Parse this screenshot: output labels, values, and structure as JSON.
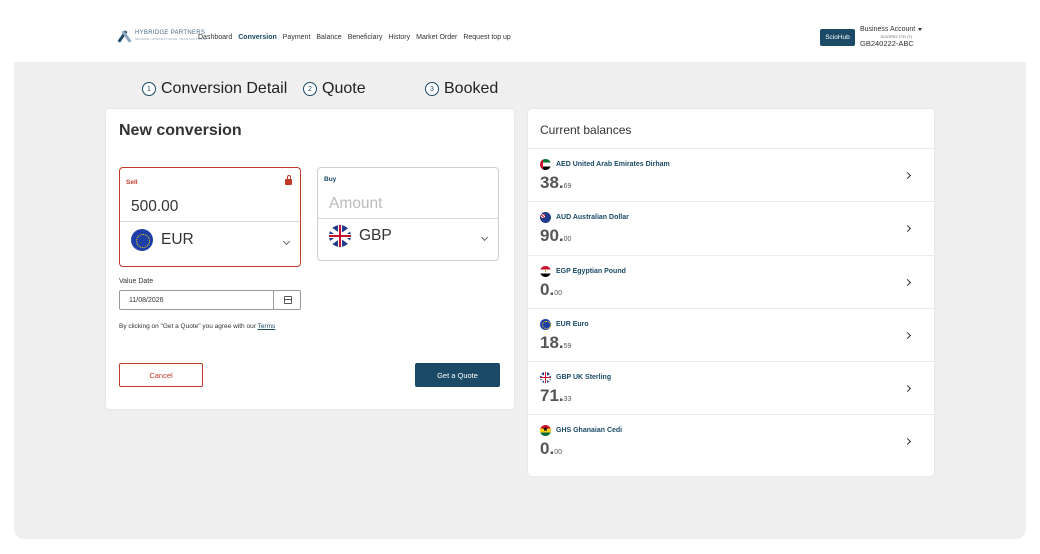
{
  "header": {
    "logo_text": "HYBRIDGE PARTNERS",
    "logo_sub": "SECURE INTERNATIONAL TRANSACTIONS",
    "nav": [
      "Dashboard",
      "Conversion",
      "Payment",
      "Balance",
      "Beneficiary",
      "History",
      "Market Order",
      "Request top up"
    ],
    "active_nav": "Conversion",
    "brand_badge": "ScioHub",
    "account_name": "Business Account",
    "account_company": "SCIOPAY LTD (T)",
    "account_id": "GB240222-ABC"
  },
  "steps": [
    {
      "num": "1",
      "label": "Conversion Detail"
    },
    {
      "num": "2",
      "label": "Quote"
    },
    {
      "num": "3",
      "label": "Booked"
    }
  ],
  "conversion": {
    "title": "New conversion",
    "sell_label": "Sell",
    "sell_amount": "500.00",
    "sell_currency": "EUR",
    "buy_label": "Buy",
    "buy_placeholder": "Amount",
    "buy_currency": "GBP",
    "value_date_label": "Value Date",
    "value_date": "11/08/2026",
    "terms_text": "By clicking on \"Get a Quote\" you agree with our ",
    "terms_link": "Terms",
    "cancel_label": "Cancel",
    "quote_label": "Get a Quote"
  },
  "balances": {
    "title": "Current balances",
    "items": [
      {
        "code": "AED",
        "name": "AED United Arab Emirates Dirham",
        "whole": "38.",
        "decimal": "69",
        "flag": "ae-flag"
      },
      {
        "code": "AUD",
        "name": "AUD Australian Dollar",
        "whole": "90.",
        "decimal": "00",
        "flag": "au-flag"
      },
      {
        "code": "EGP",
        "name": "EGP Egyptian Pound",
        "whole": "0.",
        "decimal": "00",
        "flag": "eg-flag"
      },
      {
        "code": "EUR",
        "name": "EUR Euro",
        "whole": "18.",
        "decimal": "59",
        "flag": "eu-flag"
      },
      {
        "code": "GBP",
        "name": "GBP UK Sterling",
        "whole": "71.",
        "decimal": "33",
        "flag": "gb-flag"
      },
      {
        "code": "GHS",
        "name": "GHS Ghanaian Cedi",
        "whole": "0.",
        "decimal": "00",
        "flag": "gh-flag"
      }
    ]
  },
  "colors": {
    "primary": "#1a4a66",
    "danger": "#c0392b",
    "background": "#efefef"
  }
}
